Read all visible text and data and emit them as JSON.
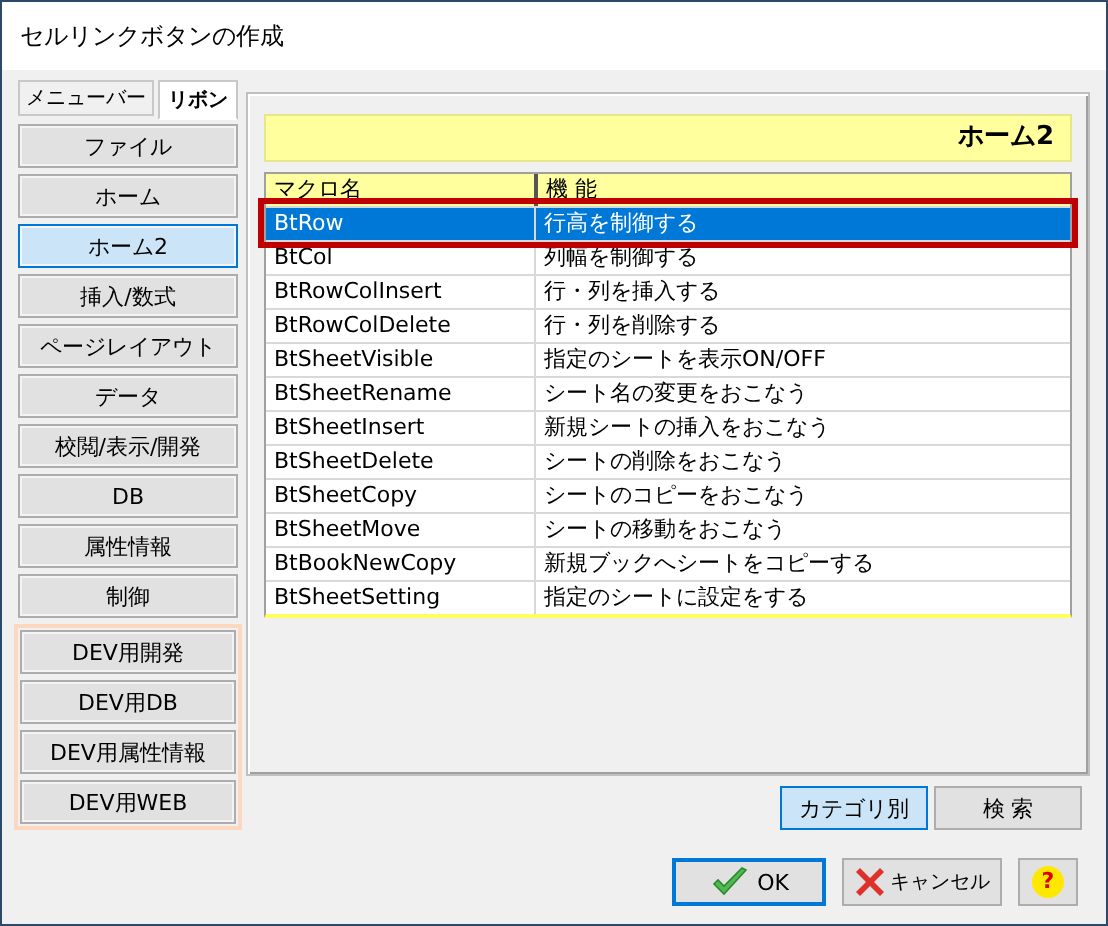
{
  "window": {
    "title": "セルリンクボタンの作成"
  },
  "tabs": [
    {
      "label": "メニューバー",
      "selected": false
    },
    {
      "label": "リボン",
      "selected": true
    }
  ],
  "categories": [
    {
      "label": "ファイル",
      "selected": false,
      "kind": "normal"
    },
    {
      "label": "ホーム",
      "selected": false,
      "kind": "normal"
    },
    {
      "label": "ホーム2",
      "selected": true,
      "kind": "normal"
    },
    {
      "label": "挿入/数式",
      "selected": false,
      "kind": "normal"
    },
    {
      "label": "ページレイアウト",
      "selected": false,
      "kind": "normal"
    },
    {
      "label": "データ",
      "selected": false,
      "kind": "normal"
    },
    {
      "label": "校閲/表示/開発",
      "selected": false,
      "kind": "normal"
    },
    {
      "label": "DB",
      "selected": false,
      "kind": "normal"
    },
    {
      "label": "属性情報",
      "selected": false,
      "kind": "normal"
    },
    {
      "label": "制御",
      "selected": false,
      "kind": "normal"
    },
    {
      "label": "DEV用開発",
      "selected": false,
      "kind": "dev"
    },
    {
      "label": "DEV用DB",
      "selected": false,
      "kind": "dev"
    },
    {
      "label": "DEV用属性情報",
      "selected": false,
      "kind": "dev"
    },
    {
      "label": "DEV用WEB",
      "selected": false,
      "kind": "dev"
    }
  ],
  "panel": {
    "title": "ホーム2"
  },
  "table": {
    "columns": [
      "マクロ名",
      "機 能"
    ],
    "rows": [
      {
        "name": "BtRow",
        "description": "行高を制御する",
        "selected": true
      },
      {
        "name": "BtCol",
        "description": "列幅を制御する",
        "selected": false
      },
      {
        "name": "BtRowColInsert",
        "description": "行・列を挿入する",
        "selected": false
      },
      {
        "name": "BtRowColDelete",
        "description": "行・列を削除する",
        "selected": false
      },
      {
        "name": "BtSheetVisible",
        "description": "指定のシートを表示ON/OFF",
        "selected": false
      },
      {
        "name": "BtSheetRename",
        "description": "シート名の変更をおこなう",
        "selected": false
      },
      {
        "name": "BtSheetInsert",
        "description": "新規シートの挿入をおこなう",
        "selected": false
      },
      {
        "name": "BtSheetDelete",
        "description": "シートの削除をおこなう",
        "selected": false
      },
      {
        "name": "BtSheetCopy",
        "description": "シートのコピーをおこなう",
        "selected": false
      },
      {
        "name": "BtSheetMove",
        "description": "シートの移動をおこなう",
        "selected": false
      },
      {
        "name": "BtBookNewCopy",
        "description": "新規ブックへシートをコピーする",
        "selected": false
      },
      {
        "name": "BtSheetSetting",
        "description": "指定のシートに設定をする",
        "selected": false
      }
    ]
  },
  "view_tabs": [
    {
      "label": "カテゴリ別",
      "selected": true
    },
    {
      "label": "検 索",
      "selected": false
    }
  ],
  "buttons": [
    {
      "label": "OK",
      "kind": "ok"
    },
    {
      "label": "キャンセル",
      "kind": "cancel"
    },
    {
      "label": "?",
      "kind": "help"
    }
  ]
}
